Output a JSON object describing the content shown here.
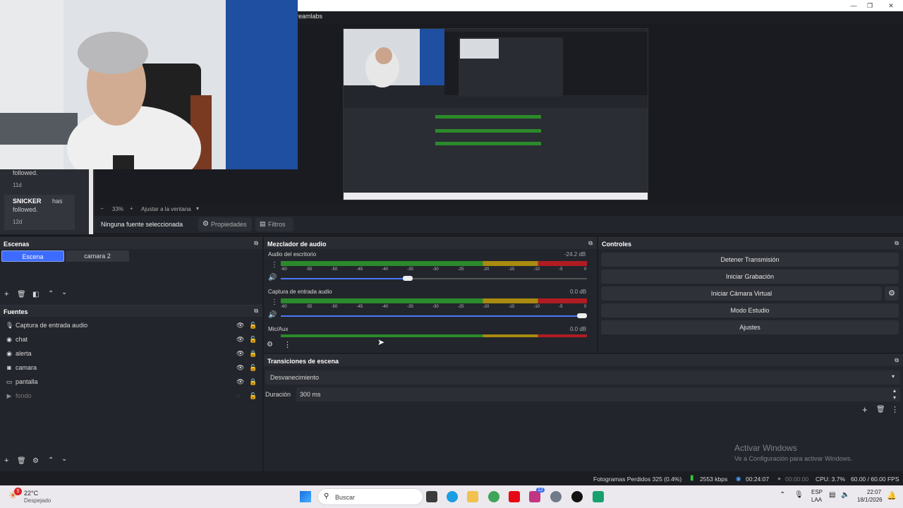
{
  "window": {
    "title": "reamlabs",
    "min": "—",
    "max": "❐",
    "close": "✕"
  },
  "chat": {
    "prev_text": "followed.",
    "prev_time": "11d",
    "user": "SNICKER",
    "has": "has",
    "followed": "followed.",
    "time": "12d"
  },
  "zoom": {
    "minus": "−",
    "value": "33%",
    "plus": "+",
    "fit": "Ajustar a la ventana",
    "caret": "▾"
  },
  "source_bar": {
    "no_source": "Ninguna fuente seleccionada",
    "properties": "Propiedades",
    "filters": "Filtros"
  },
  "scenes": {
    "title": "Escenas",
    "items": [
      {
        "label": "Escena"
      },
      {
        "label": "camara 2"
      }
    ]
  },
  "sources": {
    "title": "Fuentes",
    "items": [
      {
        "label": "Captura de entrada audio",
        "icon": "mic-icon"
      },
      {
        "label": "chat",
        "icon": "globe-icon"
      },
      {
        "label": "alerta",
        "icon": "globe-icon"
      },
      {
        "label": "camara",
        "icon": "camera-icon"
      },
      {
        "label": "pantalla",
        "icon": "monitor-icon"
      },
      {
        "label": "fondo",
        "icon": "play-icon"
      }
    ]
  },
  "mixer": {
    "title": "Mezclador de audio",
    "channels": [
      {
        "name": "Audio del escritorio",
        "db": "-24.2 dB",
        "volume": 0.43
      },
      {
        "name": "Captura de entrada audio",
        "db": "0.0 dB",
        "volume": 1.0
      },
      {
        "name": "Mic/Aux",
        "db": "0.0 dB",
        "volume": 1.0
      }
    ],
    "ticks": [
      "-60",
      "-55",
      "-50",
      "-45",
      "-40",
      "-35",
      "-30",
      "-25",
      "-20",
      "-15",
      "-10",
      "-5",
      "0"
    ]
  },
  "controls": {
    "title": "Controles",
    "stop_stream": "Detener Transmisión",
    "start_recording": "Iniciar Grabación",
    "virtual_cam": "Iniciar Cámara Virtual",
    "studio_mode": "Modo Estudio",
    "settings": "Ajustes"
  },
  "transitions": {
    "title": "Transiciones de escena",
    "selected": "Desvanecimiento",
    "duration_label": "Duración",
    "duration_value": "300 ms"
  },
  "watermark": {
    "title": "Activar Windows",
    "subtitle": "Ve a Configuración para activar Windows."
  },
  "status": {
    "dropped": "Fotogramas Perdidos 325 (0.4%)",
    "bitrate": "2553 kbps",
    "live_time": "00:24:07",
    "rec_time": "00:00:00",
    "cpu": "CPU: 3.7%",
    "fps": "60.00 / 60.00 FPS"
  },
  "taskbar": {
    "temp": "22°C",
    "weather": "Despejado",
    "badge": "5",
    "search": "Buscar",
    "lang1": "ESP",
    "lang2": "LAA",
    "time": "22:07",
    "date": "18/1/2026",
    "notif_badge": "12"
  },
  "colors": {
    "accent": "#3d6bff",
    "panel": "#23252c",
    "green": "#2b8a2b",
    "yellow": "#a88b10",
    "red": "#b01c22"
  }
}
